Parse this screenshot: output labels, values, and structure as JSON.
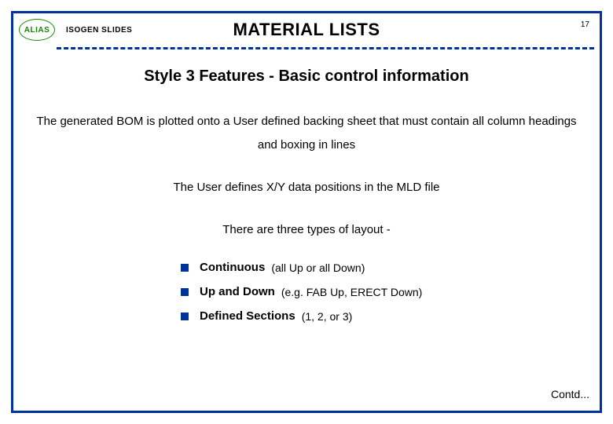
{
  "header": {
    "badge": "ALIAS",
    "subtitle": "ISOGEN SLIDES",
    "title": "MATERIAL LISTS",
    "page": "17"
  },
  "section_title": "Style 3 Features - Basic control information",
  "paragraphs": {
    "p1": "The generated BOM is plotted onto a User defined backing sheet that must contain all column headings and boxing in lines",
    "p2": "The User defines X/Y data positions in the MLD file",
    "p3": "There are three types of layout -"
  },
  "list": [
    {
      "term": "Continuous",
      "note": "(all Up or all Down)"
    },
    {
      "term": "Up and Down",
      "note": "(e.g. FAB Up, ERECT Down)"
    },
    {
      "term": "Defined Sections",
      "note": "(1, 2, or 3)"
    }
  ],
  "footer": {
    "contd": "Contd..."
  }
}
